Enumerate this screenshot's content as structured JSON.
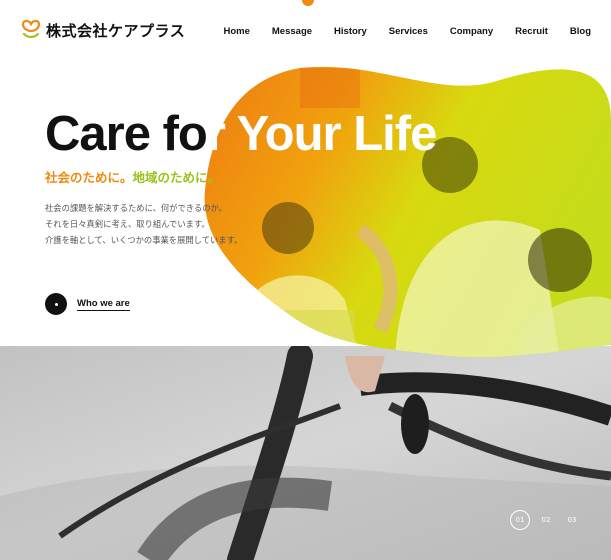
{
  "brand": {
    "name": "株式会社ケアプラス",
    "accent": "#f28a12",
    "green": "#9cc31a"
  },
  "nav": {
    "items": [
      "Home",
      "Message",
      "History",
      "Services",
      "Company",
      "Recruit",
      "Blog"
    ]
  },
  "hero": {
    "headline_dark": "Care fo",
    "headline_light": "r Your Life",
    "tagline_a": "社会のために。",
    "tagline_b": "地域のために。",
    "desc": [
      "社会の課題を解決するために、何ができるのか。",
      "それを日々真剣に考え、取り組んでいます。",
      "介護を軸として、いくつかの事業を展開しています。"
    ],
    "cta_label": "Who we are"
  },
  "slider": {
    "pages": [
      "01",
      "02",
      "03"
    ],
    "active_index": 0
  }
}
